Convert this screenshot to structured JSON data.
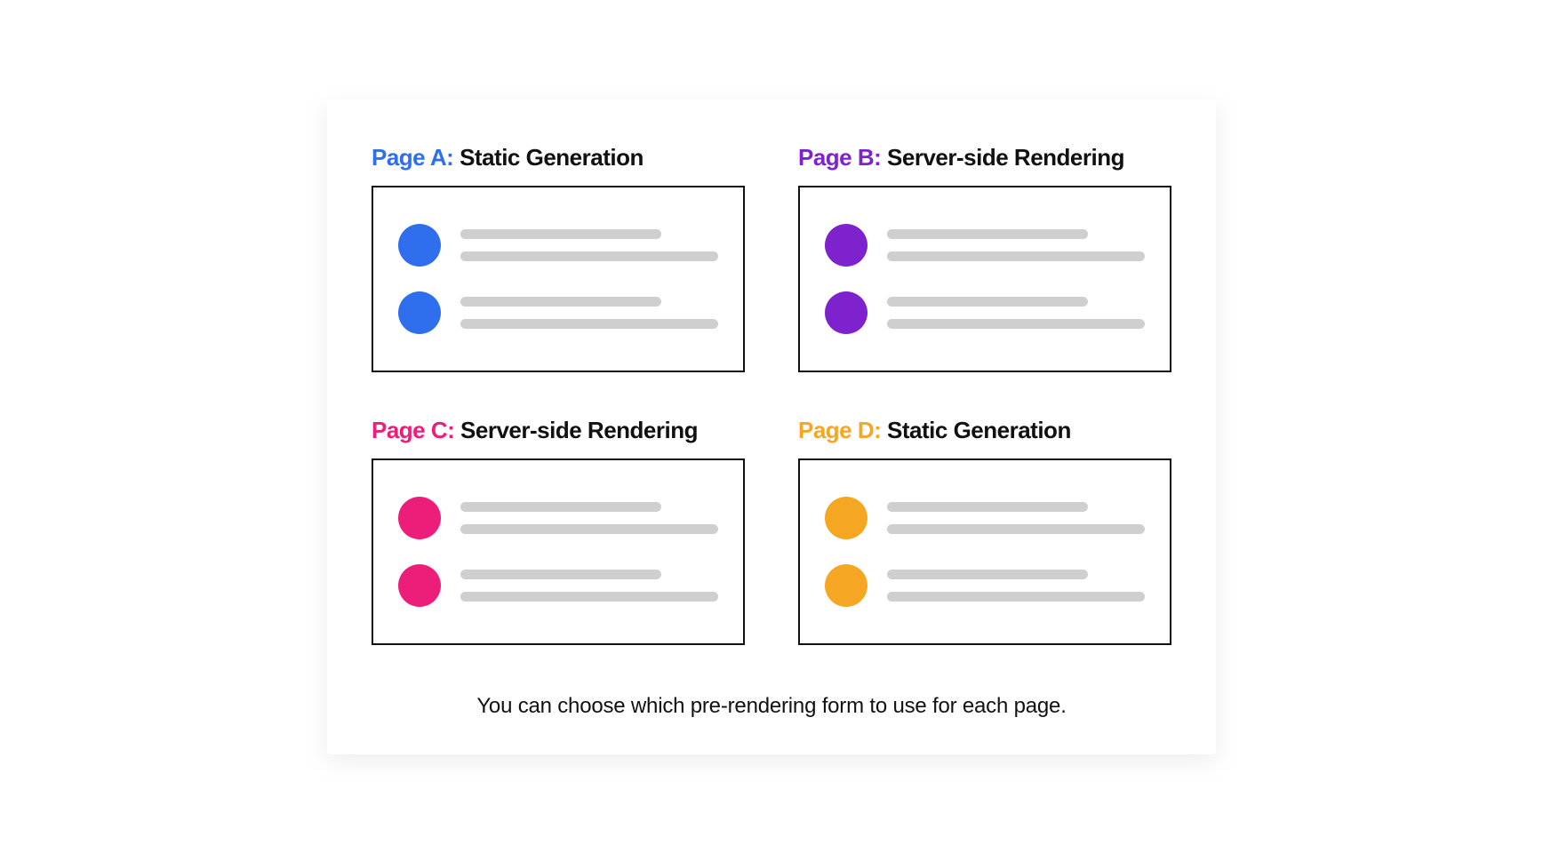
{
  "tiles": [
    {
      "label": "Page A:",
      "method": "Static Generation",
      "color": "#2f6fed"
    },
    {
      "label": "Page B:",
      "method": "Server-side Rendering",
      "color": "#7e22ce"
    },
    {
      "label": "Page C:",
      "method": "Server-side Rendering",
      "color": "#ec1e79"
    },
    {
      "label": "Page D:",
      "method": "Static Generation",
      "color": "#f5a623"
    }
  ],
  "caption": "You can choose which pre-rendering form to use for each page."
}
